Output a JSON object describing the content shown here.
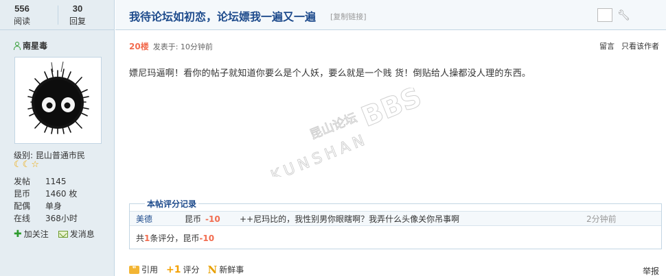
{
  "stats": {
    "views_count": "556",
    "views_label": "阅读",
    "replies_count": "30",
    "replies_label": "回复"
  },
  "thread": {
    "title": "我待论坛如初恋，论坛嫖我一遍又一遍",
    "copy_link": "[复制链接]"
  },
  "author": {
    "name": "南星毒",
    "level": "级别: 昆山普通市民",
    "info": [
      {
        "key": "发帖",
        "value": "1145"
      },
      {
        "key": "昆币",
        "value": "1460 枚"
      },
      {
        "key": "配偶",
        "value": "单身"
      },
      {
        "key": "在线",
        "value": "368小时"
      }
    ],
    "follow_label": "加关注",
    "message_label": "发消息"
  },
  "post": {
    "floor": "20楼",
    "posted_at": "发表于: 10分钟前",
    "comment_label": "留言",
    "only_author_label": "只看该作者",
    "body": "嫖尼玛逼啊！看你的帖子就知道你要么是个人妖，要么就是一个贱 货！倒贴给人操都没人理的东西。"
  },
  "rating": {
    "title": "本帖评分记录",
    "entries": [
      {
        "user": "美德",
        "category": "昆币",
        "value": "-10",
        "reason": "++尼玛比的，我性别男你眼瞎啊？我弄什么头像关你吊事啊",
        "time": "2分钟前"
      }
    ],
    "summary_prefix": "共",
    "summary_count": "1",
    "summary_mid": "条评分，昆币",
    "summary_value": "-10"
  },
  "footer": {
    "quote_label": "引用",
    "rate_label": "评分",
    "news_label": "新鲜事",
    "report_label": "举报"
  },
  "watermark": {
    "text_cn": "昆山论坛",
    "text_en": "KUNSHAN",
    "text_bbs": "BBS"
  },
  "colors": {
    "sidebar_bg": "#e5edf2",
    "border": "#c2d5e3",
    "title_blue": "#1e4b8c",
    "accent_orange": "#f26c4f"
  }
}
